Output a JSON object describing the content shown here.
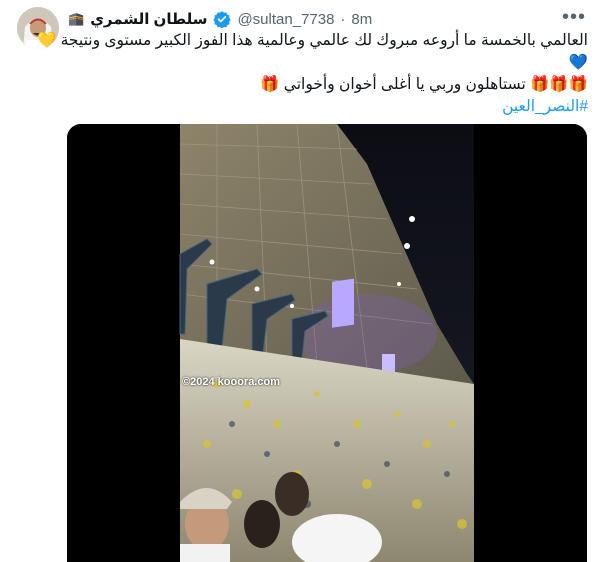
{
  "tweet": {
    "author_name": "سلطان الشمري",
    "author_emoji": "🕋",
    "handle": "@sultan_7738",
    "separator": "·",
    "time": "8m",
    "more_glyph": "•••",
    "text_line1": "العالمي بالخمسة ما أروعه مبروك لك عالمي وعالمية هذا الفوز الكبير مستوى ونتيجة 💛",
    "text_line2": "💙",
    "text_line3": "🎁🎁🎁 تستاهلون وربي يا أغلى أخوان وأخواتي 🎁",
    "hashtag": "#النصر_العين"
  },
  "media": {
    "watermark": "©2024 kooora.com"
  },
  "colors": {
    "accent": "#1d9bf0",
    "muted": "#536471"
  }
}
